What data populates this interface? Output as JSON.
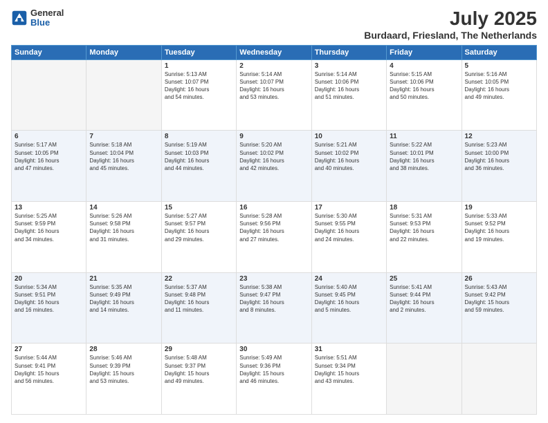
{
  "header": {
    "logo_general": "General",
    "logo_blue": "Blue",
    "month_title": "July 2025",
    "location": "Burdaard, Friesland, The Netherlands"
  },
  "days_of_week": [
    "Sunday",
    "Monday",
    "Tuesday",
    "Wednesday",
    "Thursday",
    "Friday",
    "Saturday"
  ],
  "weeks": [
    [
      {
        "day": "",
        "info": ""
      },
      {
        "day": "",
        "info": ""
      },
      {
        "day": "1",
        "info": "Sunrise: 5:13 AM\nSunset: 10:07 PM\nDaylight: 16 hours\nand 54 minutes."
      },
      {
        "day": "2",
        "info": "Sunrise: 5:14 AM\nSunset: 10:07 PM\nDaylight: 16 hours\nand 53 minutes."
      },
      {
        "day": "3",
        "info": "Sunrise: 5:14 AM\nSunset: 10:06 PM\nDaylight: 16 hours\nand 51 minutes."
      },
      {
        "day": "4",
        "info": "Sunrise: 5:15 AM\nSunset: 10:06 PM\nDaylight: 16 hours\nand 50 minutes."
      },
      {
        "day": "5",
        "info": "Sunrise: 5:16 AM\nSunset: 10:05 PM\nDaylight: 16 hours\nand 49 minutes."
      }
    ],
    [
      {
        "day": "6",
        "info": "Sunrise: 5:17 AM\nSunset: 10:05 PM\nDaylight: 16 hours\nand 47 minutes."
      },
      {
        "day": "7",
        "info": "Sunrise: 5:18 AM\nSunset: 10:04 PM\nDaylight: 16 hours\nand 45 minutes."
      },
      {
        "day": "8",
        "info": "Sunrise: 5:19 AM\nSunset: 10:03 PM\nDaylight: 16 hours\nand 44 minutes."
      },
      {
        "day": "9",
        "info": "Sunrise: 5:20 AM\nSunset: 10:02 PM\nDaylight: 16 hours\nand 42 minutes."
      },
      {
        "day": "10",
        "info": "Sunrise: 5:21 AM\nSunset: 10:02 PM\nDaylight: 16 hours\nand 40 minutes."
      },
      {
        "day": "11",
        "info": "Sunrise: 5:22 AM\nSunset: 10:01 PM\nDaylight: 16 hours\nand 38 minutes."
      },
      {
        "day": "12",
        "info": "Sunrise: 5:23 AM\nSunset: 10:00 PM\nDaylight: 16 hours\nand 36 minutes."
      }
    ],
    [
      {
        "day": "13",
        "info": "Sunrise: 5:25 AM\nSunset: 9:59 PM\nDaylight: 16 hours\nand 34 minutes."
      },
      {
        "day": "14",
        "info": "Sunrise: 5:26 AM\nSunset: 9:58 PM\nDaylight: 16 hours\nand 31 minutes."
      },
      {
        "day": "15",
        "info": "Sunrise: 5:27 AM\nSunset: 9:57 PM\nDaylight: 16 hours\nand 29 minutes."
      },
      {
        "day": "16",
        "info": "Sunrise: 5:28 AM\nSunset: 9:56 PM\nDaylight: 16 hours\nand 27 minutes."
      },
      {
        "day": "17",
        "info": "Sunrise: 5:30 AM\nSunset: 9:55 PM\nDaylight: 16 hours\nand 24 minutes."
      },
      {
        "day": "18",
        "info": "Sunrise: 5:31 AM\nSunset: 9:53 PM\nDaylight: 16 hours\nand 22 minutes."
      },
      {
        "day": "19",
        "info": "Sunrise: 5:33 AM\nSunset: 9:52 PM\nDaylight: 16 hours\nand 19 minutes."
      }
    ],
    [
      {
        "day": "20",
        "info": "Sunrise: 5:34 AM\nSunset: 9:51 PM\nDaylight: 16 hours\nand 16 minutes."
      },
      {
        "day": "21",
        "info": "Sunrise: 5:35 AM\nSunset: 9:49 PM\nDaylight: 16 hours\nand 14 minutes."
      },
      {
        "day": "22",
        "info": "Sunrise: 5:37 AM\nSunset: 9:48 PM\nDaylight: 16 hours\nand 11 minutes."
      },
      {
        "day": "23",
        "info": "Sunrise: 5:38 AM\nSunset: 9:47 PM\nDaylight: 16 hours\nand 8 minutes."
      },
      {
        "day": "24",
        "info": "Sunrise: 5:40 AM\nSunset: 9:45 PM\nDaylight: 16 hours\nand 5 minutes."
      },
      {
        "day": "25",
        "info": "Sunrise: 5:41 AM\nSunset: 9:44 PM\nDaylight: 16 hours\nand 2 minutes."
      },
      {
        "day": "26",
        "info": "Sunrise: 5:43 AM\nSunset: 9:42 PM\nDaylight: 15 hours\nand 59 minutes."
      }
    ],
    [
      {
        "day": "27",
        "info": "Sunrise: 5:44 AM\nSunset: 9:41 PM\nDaylight: 15 hours\nand 56 minutes."
      },
      {
        "day": "28",
        "info": "Sunrise: 5:46 AM\nSunset: 9:39 PM\nDaylight: 15 hours\nand 53 minutes."
      },
      {
        "day": "29",
        "info": "Sunrise: 5:48 AM\nSunset: 9:37 PM\nDaylight: 15 hours\nand 49 minutes."
      },
      {
        "day": "30",
        "info": "Sunrise: 5:49 AM\nSunset: 9:36 PM\nDaylight: 15 hours\nand 46 minutes."
      },
      {
        "day": "31",
        "info": "Sunrise: 5:51 AM\nSunset: 9:34 PM\nDaylight: 15 hours\nand 43 minutes."
      },
      {
        "day": "",
        "info": ""
      },
      {
        "day": "",
        "info": ""
      }
    ]
  ]
}
